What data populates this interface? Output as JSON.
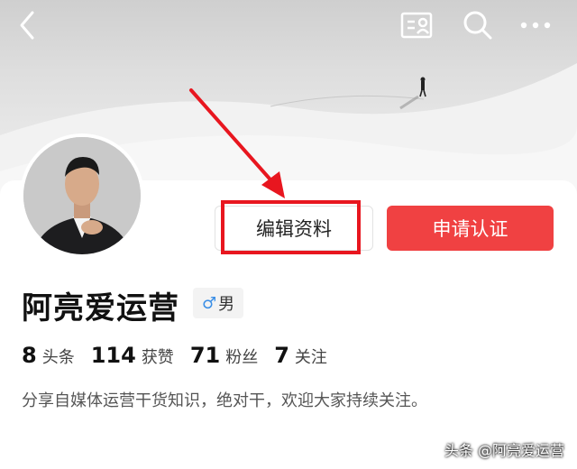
{
  "profile": {
    "name": "阿亮爱运营",
    "gender_symbol": "♂",
    "gender_label": "男",
    "bio": "分享自媒体运营干货知识，绝对干，欢迎大家持续关注。"
  },
  "stats": [
    {
      "value": "8",
      "label": "头条"
    },
    {
      "value": "114",
      "label": "获赞"
    },
    {
      "value": "71",
      "label": "粉丝"
    },
    {
      "value": "7",
      "label": "关注"
    }
  ],
  "actions": {
    "edit_label": "编辑资料",
    "certify_label": "申请认证"
  },
  "topbar": {
    "icons": [
      "back-icon",
      "profile-card-icon",
      "search-icon",
      "more-icon"
    ]
  },
  "watermark": "头条 @阿亮爱运营",
  "colors": {
    "accent": "#f04142",
    "annotation": "#e8161f",
    "gender_male": "#3a8ee6"
  }
}
